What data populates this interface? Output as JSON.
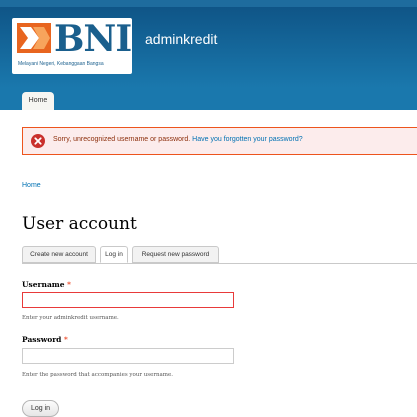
{
  "header": {
    "logo_text": "BNI",
    "logo_tagline": "Melayani Negeri, Kebanggaan Bangsa",
    "site_name": "adminkredit"
  },
  "nav": {
    "home_tab": "Home"
  },
  "message": {
    "error_text": "Sorry, unrecognized username or password.",
    "error_link": "Have you forgotten your password?"
  },
  "breadcrumb": {
    "home": "Home"
  },
  "page": {
    "title": "User account"
  },
  "tabs": [
    {
      "label": "Create new account",
      "active": false
    },
    {
      "label": "Log in",
      "active": true
    },
    {
      "label": "Request new password",
      "active": false
    }
  ],
  "form": {
    "username": {
      "label": "Username",
      "required_mark": "*",
      "value": "",
      "description": "Enter your adminkredit username."
    },
    "password": {
      "label": "Password",
      "required_mark": "*",
      "value": "",
      "description": "Enter the password that accompanies your username."
    },
    "submit_label": "Log in"
  },
  "colors": {
    "header_blue": "#1a78ad",
    "error_border": "#ed541d",
    "link_blue": "#0071b3",
    "required_red": "#ea2800"
  }
}
